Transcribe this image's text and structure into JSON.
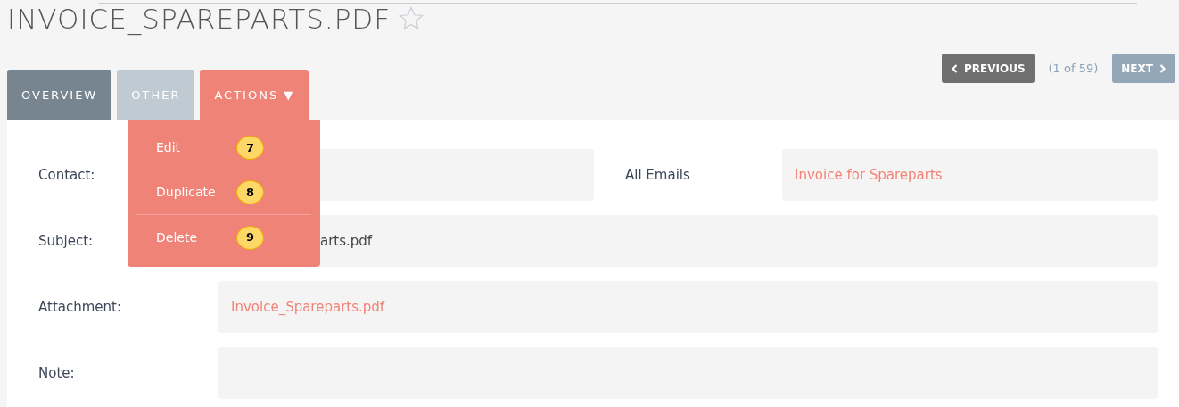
{
  "title": "INVOICE_SPAREPARTS.PDF",
  "favorite": false,
  "tabs": [
    {
      "label": "OVERVIEW",
      "kind": "tab",
      "selected": true
    },
    {
      "label": "OTHER",
      "kind": "tab",
      "selected": false
    },
    {
      "label": "ACTIONS",
      "kind": "menu",
      "selected": false,
      "caret": "▼",
      "expanded": true
    }
  ],
  "actions_menu": [
    {
      "label": "Edit",
      "marker": "7"
    },
    {
      "label": "Duplicate",
      "marker": "8"
    },
    {
      "label": "Delete",
      "marker": "9"
    }
  ],
  "pager": {
    "previous": "PREVIOUS",
    "position": "(1 of 59)",
    "next": "NEXT"
  },
  "fields": [
    {
      "label": "Contact:",
      "extra": {
        "label": "All Emails",
        "value": "Invoice for Spareparts",
        "link": true
      }
    },
    {
      "label": "Subject:",
      "value": "arts.pdf",
      "link": false
    },
    {
      "label": "Attachment:",
      "value": "Invoice_Spareparts.pdf",
      "link": true
    },
    {
      "label": "Note:"
    }
  ]
}
